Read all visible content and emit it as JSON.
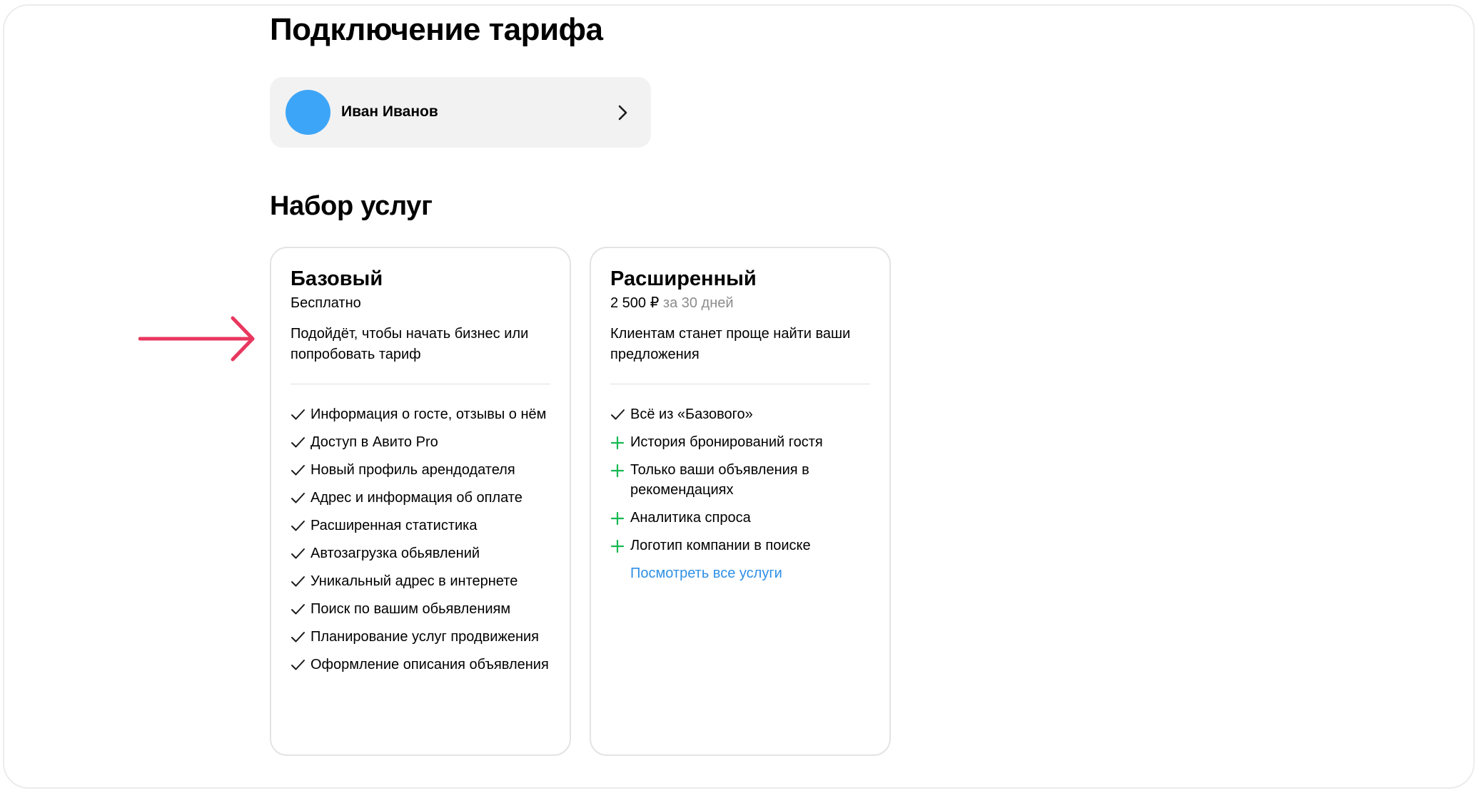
{
  "page": {
    "title": "Подключение тарифа"
  },
  "user": {
    "name": "Иван Иванов",
    "avatar_color": "#3da5f7"
  },
  "services": {
    "title": "Набор услуг"
  },
  "colors": {
    "arrow": "#e8375f",
    "plus": "#16b854",
    "link": "#2e90e6"
  },
  "plans": [
    {
      "name": "Базовый",
      "price": "Бесплатно",
      "period": "",
      "description": "Подойдёт, чтобы начать бизнес или попробовать тариф",
      "features": [
        {
          "icon": "check-icon",
          "text": "Информация о госте, отзывы о нём"
        },
        {
          "icon": "check-icon",
          "text": "Доступ в Авито Pro"
        },
        {
          "icon": "check-icon",
          "text": "Новый профиль арендодателя"
        },
        {
          "icon": "check-icon",
          "text": "Адрес и информация об оплате"
        },
        {
          "icon": "check-icon",
          "text": "Расширенная статистика"
        },
        {
          "icon": "check-icon",
          "text": "Автозагрузка обьявлений"
        },
        {
          "icon": "check-icon",
          "text": "Уникальный адрес в интернете"
        },
        {
          "icon": "check-icon",
          "text": "Поиск по вашим обьявлениям"
        },
        {
          "icon": "check-icon",
          "text": "Планирование услуг продвижения"
        },
        {
          "icon": "check-icon",
          "text": "Оформление описания объявления"
        }
      ]
    },
    {
      "name": "Расширенный",
      "price": "2 500 ₽",
      "period": "за 30 дней",
      "description": "Клиентам станет проще найти ваши предложения",
      "features": [
        {
          "icon": "check-icon",
          "text": "Всё из «Базового»"
        },
        {
          "icon": "plus-icon",
          "text": "История бронирований гостя"
        },
        {
          "icon": "plus-icon",
          "text": "Только ваши объявления в рекомендациях"
        },
        {
          "icon": "plus-icon",
          "text": "Аналитика спроса"
        },
        {
          "icon": "plus-icon",
          "text": "Логотип компании в поиске"
        }
      ],
      "link": "Посмотреть все услуги"
    }
  ]
}
